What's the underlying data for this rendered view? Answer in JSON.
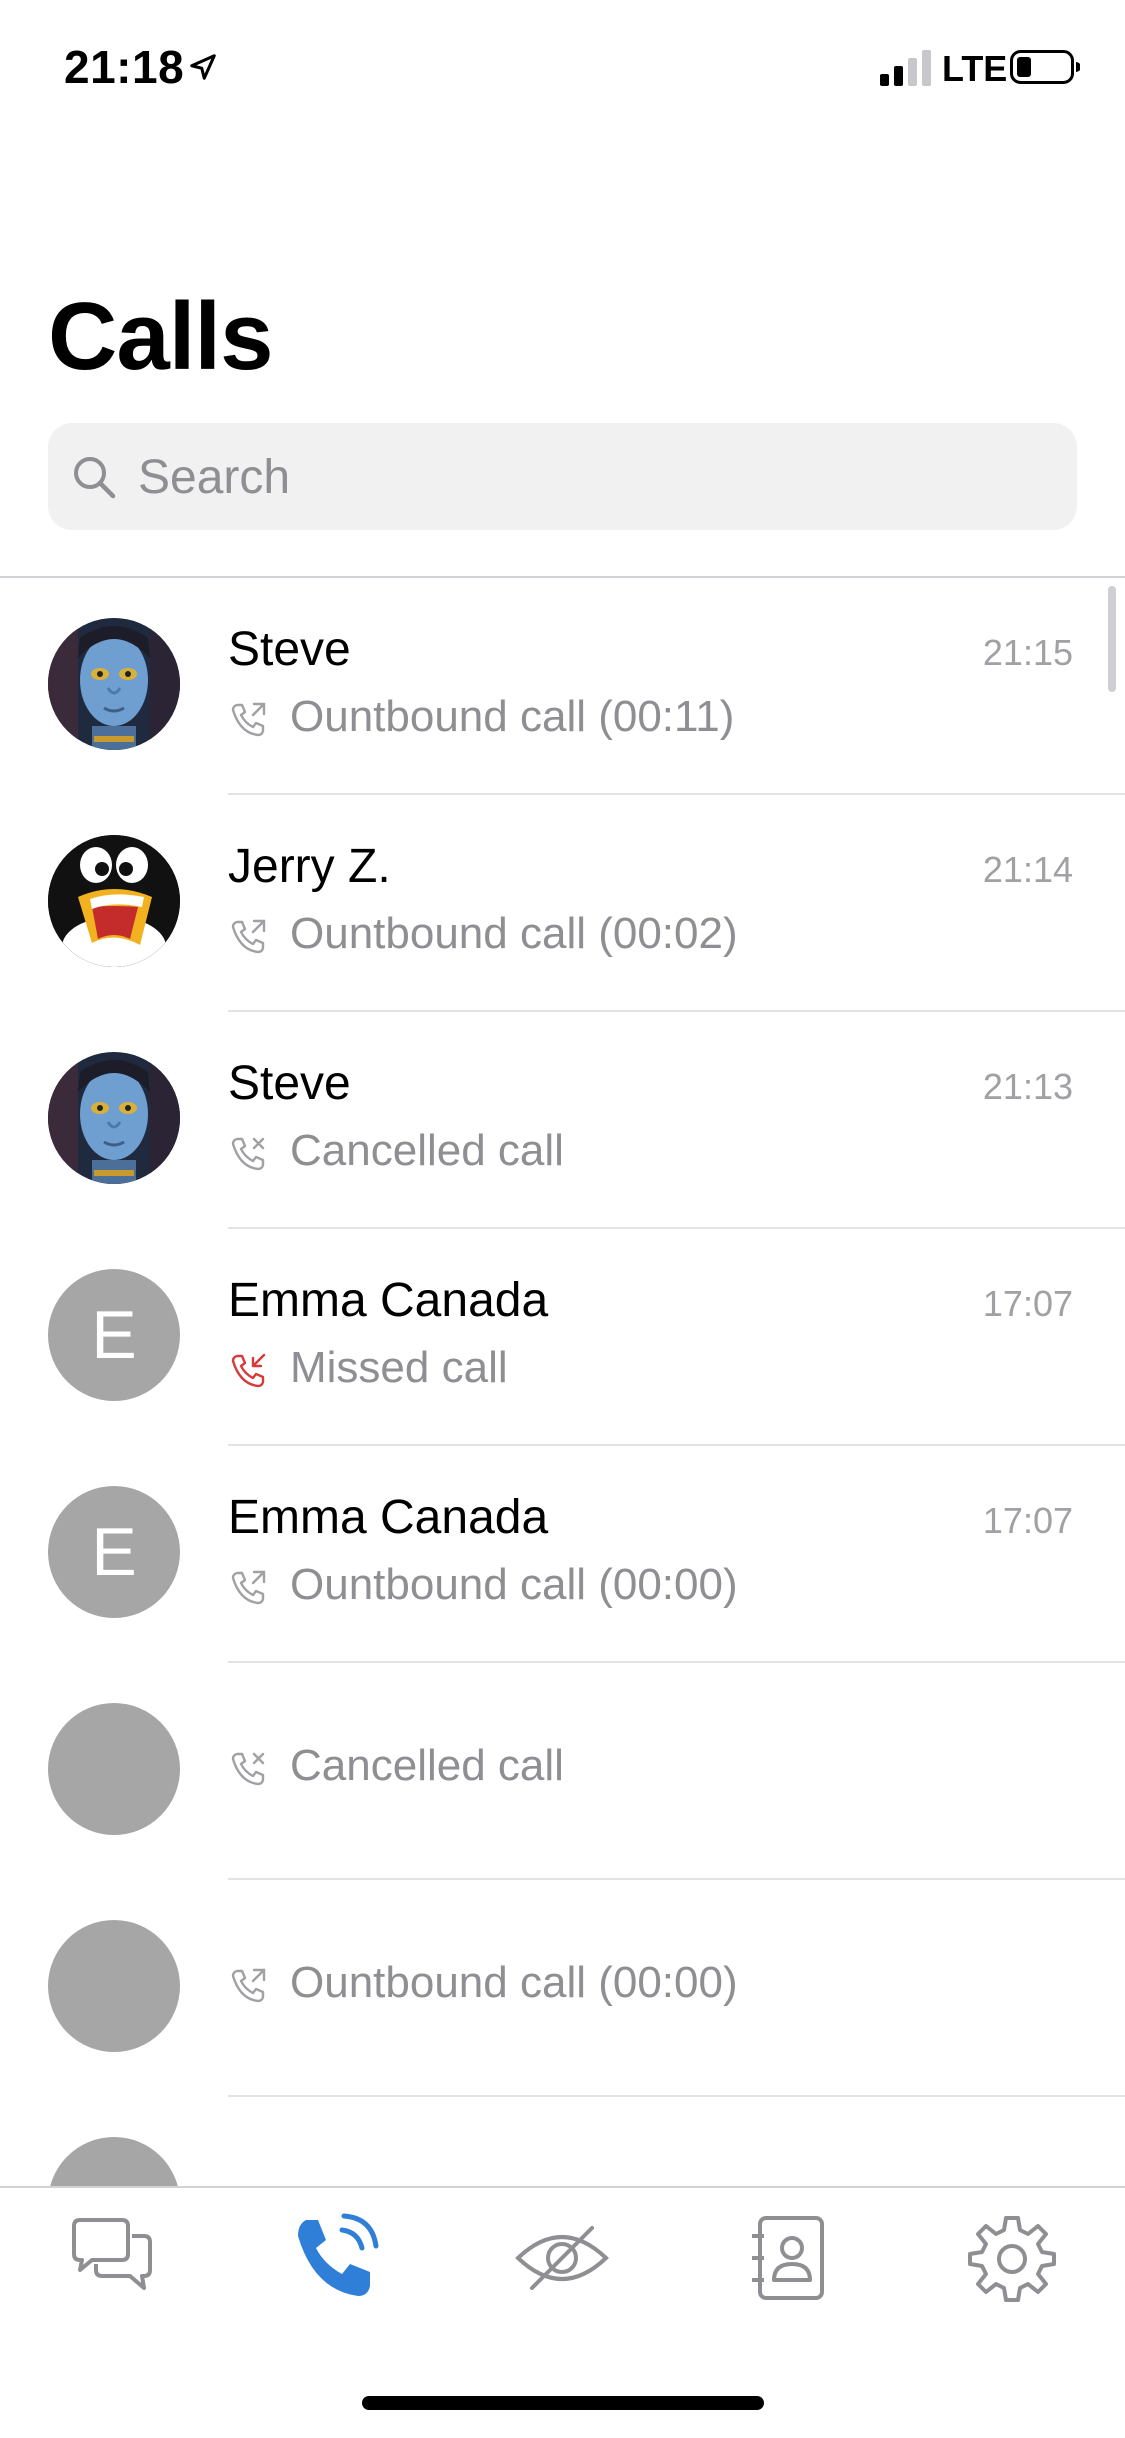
{
  "status_bar": {
    "time": "21:18",
    "network": "LTE"
  },
  "title": "Calls",
  "search": {
    "placeholder": "Search"
  },
  "calls": [
    {
      "name": "Steve",
      "time": "21:15",
      "status": "Ountbound call (00:11)",
      "type": "outbound",
      "avatar": "avatar-alien"
    },
    {
      "name": "Jerry Z.",
      "time": "21:14",
      "status": "Ountbound call (00:02)",
      "type": "outbound",
      "avatar": "avatar-penguin"
    },
    {
      "name": "Steve",
      "time": "21:13",
      "status": "Cancelled call",
      "type": "cancelled",
      "avatar": "avatar-alien"
    },
    {
      "name": "Emma Canada",
      "time": "17:07",
      "status": "Missed call",
      "type": "missed",
      "avatar_letter": "E"
    },
    {
      "name": "Emma Canada",
      "time": "17:07",
      "status": "Ountbound call (00:00)",
      "type": "outbound",
      "avatar_letter": "E"
    },
    {
      "name": "",
      "time": "",
      "status": "Cancelled call",
      "type": "cancelled"
    },
    {
      "name": "",
      "time": "",
      "status": "Ountbound call (00:00)",
      "type": "outbound"
    },
    {
      "name": "",
      "time": "",
      "status": "",
      "type": ""
    }
  ],
  "tabs": [
    {
      "id": "chats",
      "icon": "chat-bubbles-icon",
      "active": false
    },
    {
      "id": "calls",
      "icon": "phone-icon",
      "active": true
    },
    {
      "id": "private",
      "icon": "eye-slash-icon",
      "active": false
    },
    {
      "id": "contacts",
      "icon": "contacts-icon",
      "active": false
    },
    {
      "id": "settings",
      "icon": "gear-icon",
      "active": false
    }
  ],
  "colors": {
    "accent": "#2f7fd9",
    "missed": "#d63a3a",
    "secondary_text": "#8e8e93",
    "avatar_gray": "#a6a6a6"
  }
}
